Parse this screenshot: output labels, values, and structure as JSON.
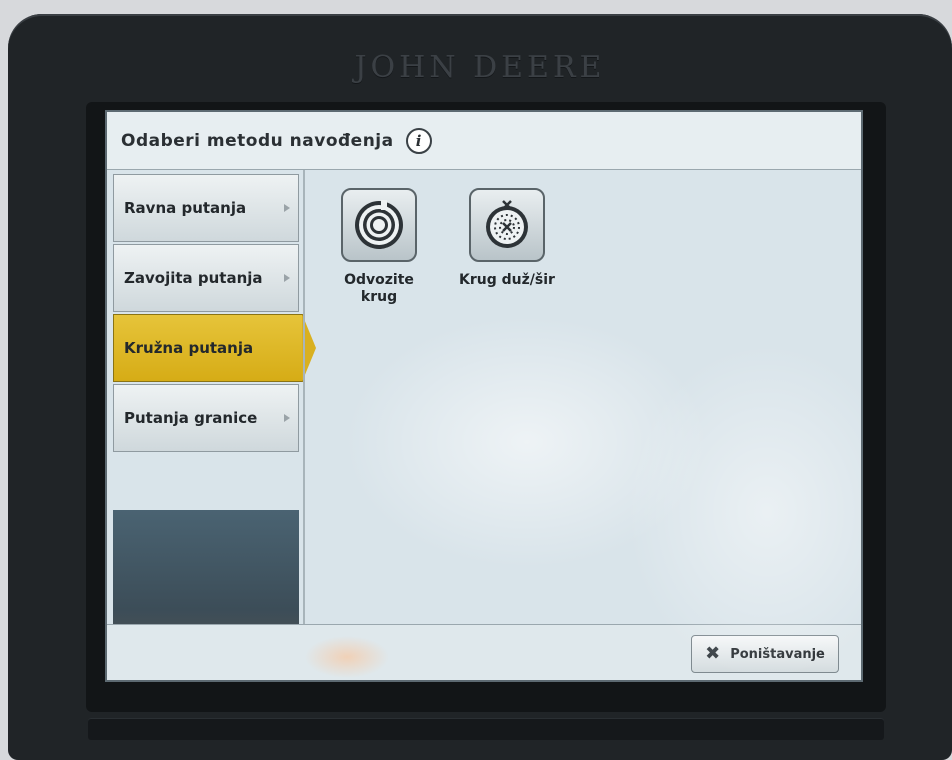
{
  "device": {
    "brand": "JOHN DEERE"
  },
  "header": {
    "title": "Odaberi metodu navođenja",
    "info_icon": "info-icon"
  },
  "sidebar": {
    "items": [
      {
        "label": "Ravna putanja",
        "active": false
      },
      {
        "label": "Zavojita putanja",
        "active": false
      },
      {
        "label": "Kružna putanja",
        "active": true
      },
      {
        "label": "Putanja granice",
        "active": false
      }
    ]
  },
  "options": [
    {
      "label_line1": "Odvozite",
      "label_line2": "krug",
      "icon": "concentric-circles-icon"
    },
    {
      "label_line1": "Krug duž/šir",
      "label_line2": "",
      "icon": "dotted-circle-icon"
    }
  ],
  "footer": {
    "cancel_label": "Poništavanje",
    "cancel_icon": "close-icon"
  },
  "colors": {
    "active_tab": "#d9b020",
    "screen_bg": "#d9e4ea",
    "bezel": "#202427"
  }
}
